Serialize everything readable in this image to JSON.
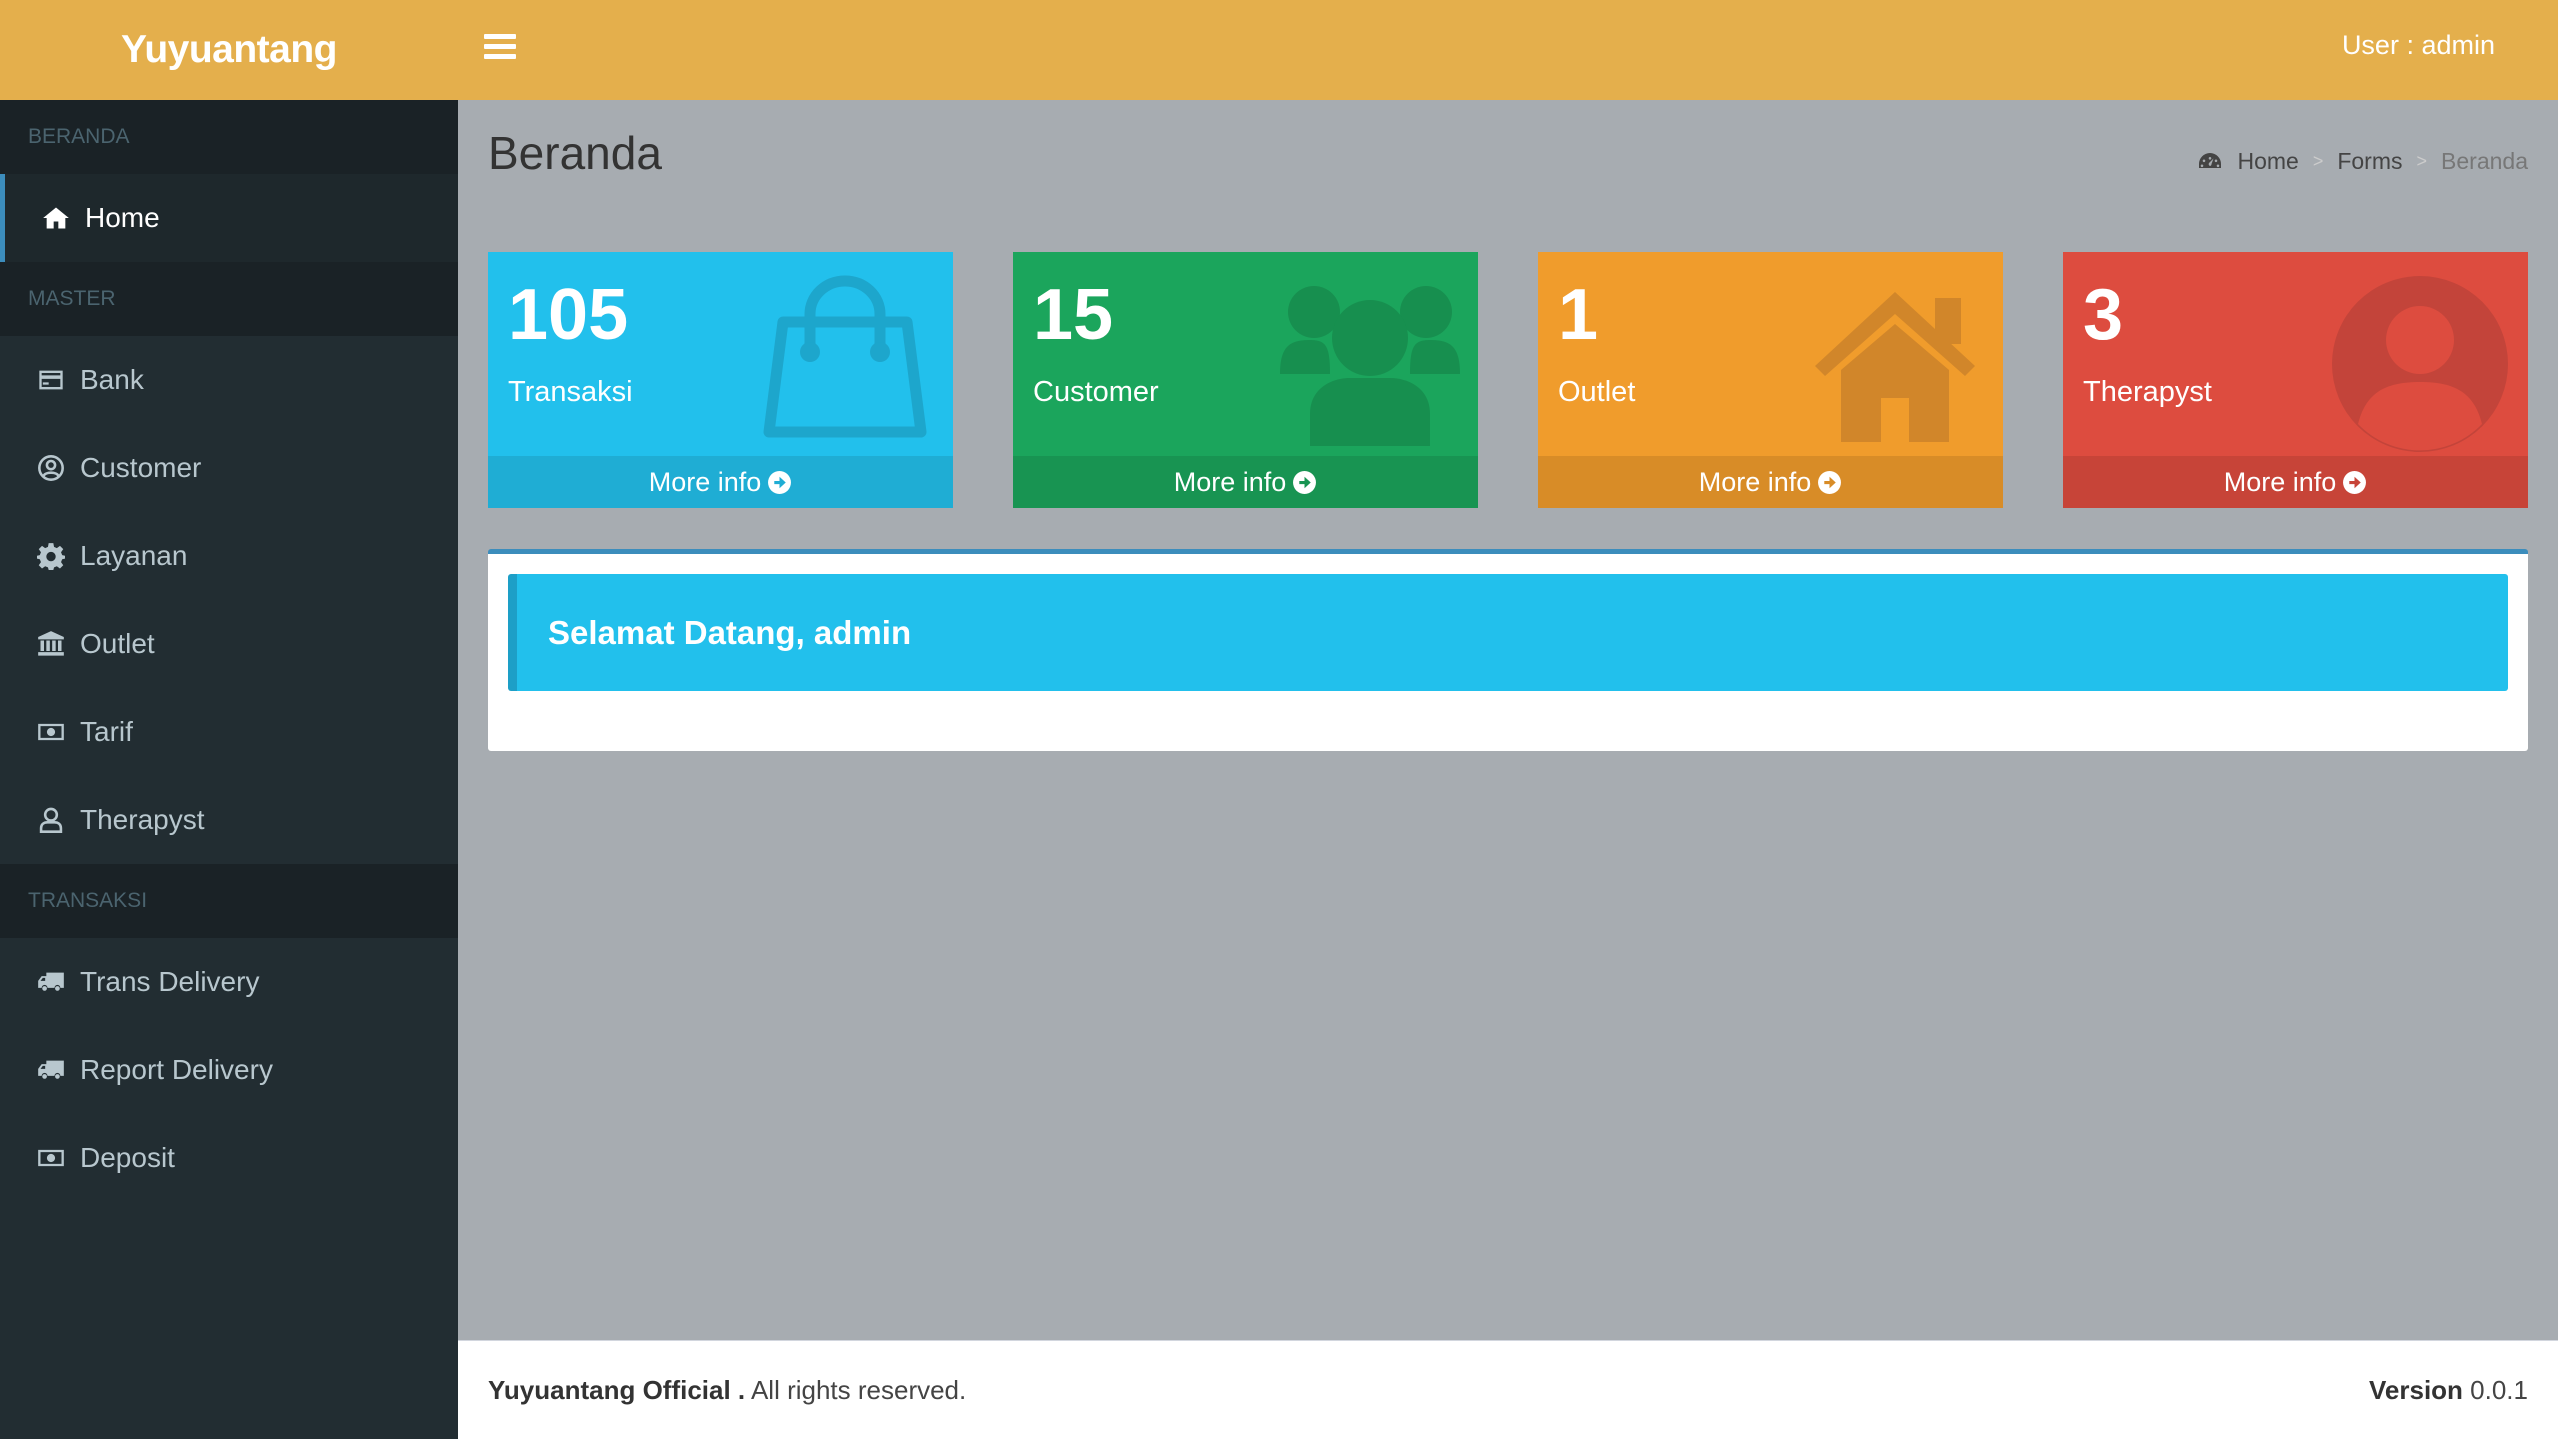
{
  "app": {
    "logo": "Yuyuantang",
    "user": "User : admin"
  },
  "sidebar": {
    "sections": [
      {
        "header": "BERANDA",
        "items": [
          {
            "label": "Home",
            "icon": "home-icon",
            "active": true
          }
        ]
      },
      {
        "header": "MASTER",
        "items": [
          {
            "label": "Bank",
            "icon": "credit-card-icon"
          },
          {
            "label": "Customer",
            "icon": "user-circle-icon"
          },
          {
            "label": "Layanan",
            "icon": "gear-icon"
          },
          {
            "label": "Outlet",
            "icon": "bank-icon"
          },
          {
            "label": "Tarif",
            "icon": "money-icon"
          },
          {
            "label": "Therapyst",
            "icon": "user-outline-icon"
          }
        ]
      },
      {
        "header": "TRANSAKSI",
        "items": [
          {
            "label": "Trans Delivery",
            "icon": "truck-icon"
          },
          {
            "label": "Report Delivery",
            "icon": "truck-icon"
          },
          {
            "label": "Deposit",
            "icon": "money-icon"
          }
        ]
      }
    ]
  },
  "page": {
    "title": "Beranda"
  },
  "breadcrumb": {
    "items": [
      "Home",
      "Forms",
      "Beranda"
    ],
    "icon": "dashboard-icon"
  },
  "stats": [
    {
      "value": "105",
      "label": "Transaksi",
      "more": "More info",
      "icon": "shopping-bag-icon",
      "color": "#22c0ec"
    },
    {
      "value": "15",
      "label": "Customer",
      "more": "More info",
      "icon": "users-icon",
      "color": "#1ba55c"
    },
    {
      "value": "1",
      "label": "Outlet",
      "more": "More info",
      "icon": "house-icon",
      "color": "#f09c2c"
    },
    {
      "value": "3",
      "label": "Therapyst",
      "more": "More info",
      "icon": "user-circle-icon",
      "color": "#dd4c3f"
    }
  ],
  "welcome": {
    "text": "Selamat Datang, admin"
  },
  "footer": {
    "brand": "Yuyuantang Official .",
    "rights": " All rights reserved.",
    "version_label": "Version",
    "version": " 0.0.1"
  }
}
